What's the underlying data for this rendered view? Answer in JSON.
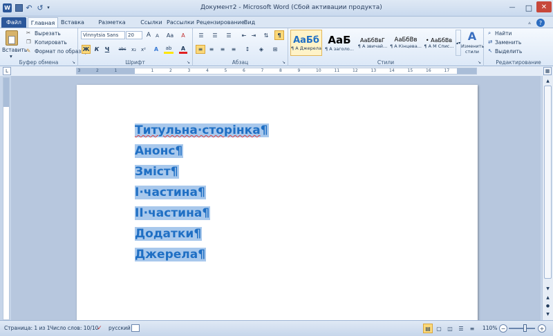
{
  "titlebar": {
    "title": "Документ2  -  Microsoft Word (Сбой активации продукта)",
    "word_icon": "W",
    "minimize": "—",
    "maximize": "□",
    "close": "✕"
  },
  "quick_access": {
    "save_icon": "save-icon",
    "undo": "↶",
    "redo": "↺"
  },
  "tabs": [
    "Файл",
    "Главная",
    "Вставка",
    "Разметка страницы",
    "Ссылки",
    "Рассылки",
    "Рецензирование",
    "Вид"
  ],
  "ribbon": {
    "clipboard": {
      "label": "Буфер обмена",
      "paste": "Вставить",
      "cut": "Вырезать",
      "copy": "Копировать",
      "format_painter": "Формат по образцу"
    },
    "font": {
      "label": "Шрифт",
      "font_name": "Vinnytsia Sans",
      "font_size": "20",
      "grow": "A",
      "shrink": "A",
      "change_case": "Aa",
      "clear": "A",
      "bold": "Ж",
      "italic": "К",
      "underline": "Ч",
      "strike": "abc",
      "sub": "x₂",
      "sup": "x²",
      "effects": "A",
      "highlight": "ab",
      "color": "A"
    },
    "paragraph": {
      "label": "Абзац",
      "pilcrow": "¶"
    },
    "styles": {
      "label": "Стили",
      "items": [
        {
          "preview": "АаБб",
          "name": "¶ А Джерела"
        },
        {
          "preview": "АаБ",
          "name": "¶ А заголо..."
        },
        {
          "preview": "АаБбВвГ",
          "name": "¶ А звичай..."
        },
        {
          "preview": "АаБбВв",
          "name": "¶ А Кінцева..."
        },
        {
          "preview": "• АаБбВв",
          "name": "¶ А М Спис..."
        }
      ],
      "change_styles": "Изменить стили"
    },
    "editing": {
      "label": "Редактирование",
      "find": "Найти",
      "replace": "Заменить",
      "select": "Выделить"
    }
  },
  "ruler": {
    "ticks": [
      "3",
      "2",
      "1",
      "1",
      "2",
      "3",
      "4",
      "5",
      "6",
      "7",
      "8",
      "9",
      "10",
      "11",
      "12",
      "13",
      "14",
      "15",
      "16",
      "17"
    ]
  },
  "document": {
    "lines": [
      "Титульна·сторінка",
      "Анонс",
      "Зміст",
      "І·частина",
      "ІІ·частина",
      "Додатки",
      "Джерела"
    ],
    "pilcrow": "¶"
  },
  "status": {
    "page": "Страница: 1 из 1",
    "words": "Число слов: 10/10",
    "language": "русский",
    "zoom": "110%",
    "minus": "−",
    "plus": "+"
  },
  "colors": {
    "accent": "#2b579a",
    "text_blue": "#1f6fc4",
    "highlight": "#a8c8ec"
  }
}
